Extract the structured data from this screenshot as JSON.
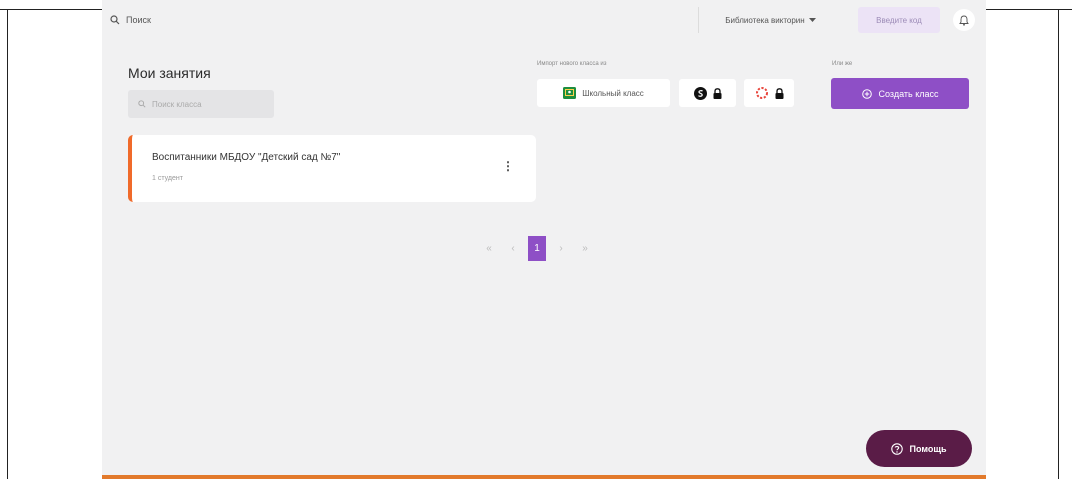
{
  "topbar": {
    "search_placeholder": "Поиск",
    "library_label": "Библиотека викторин",
    "join_code_label": "Введите код",
    "icons": {
      "search": "search-icon",
      "dropdown": "chevron-down-icon",
      "notifications": "bell-icon"
    }
  },
  "main": {
    "title": "Мои занятия",
    "class_search_placeholder": "Поиск класса",
    "import_label": "Импорт нового класса из",
    "or_label": "Или же",
    "import_google_label": "Школьный класс",
    "create_class_label": "Создать класс"
  },
  "classes": [
    {
      "name": "Воспитанники МБДОУ \"Детский сад №7\"",
      "count": "1 студент",
      "menu": "⋮"
    }
  ],
  "pagination": {
    "first": "«",
    "prev": "‹",
    "current": "1",
    "next": "›",
    "last": "»"
  },
  "help": {
    "label": "Помощь"
  },
  "colors": {
    "accent": "#8e4fc6",
    "help_bg": "#5a1c47",
    "card_stripe": "#f06a2a",
    "google_green": "#1e8e3e"
  }
}
